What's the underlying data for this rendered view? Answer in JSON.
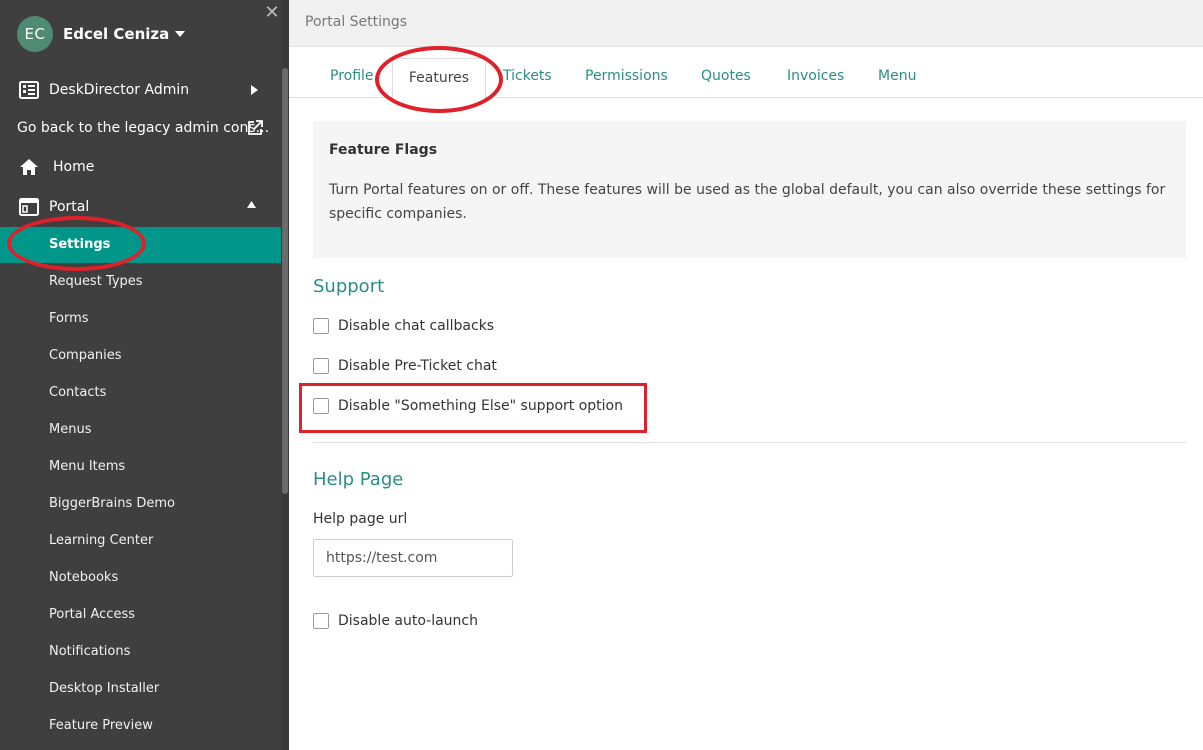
{
  "sidebar": {
    "user": {
      "initials": "EC",
      "name": "Edcel Ceniza"
    },
    "close_icon": "close-icon",
    "nav": {
      "deskdirector_admin": "DeskDirector Admin",
      "legacy_admin": "Go back to the legacy admin cons...",
      "home": "Home",
      "portal": "Portal"
    },
    "active_item": "Settings",
    "portal_items": [
      "Request Types",
      "Forms",
      "Companies",
      "Contacts",
      "Menus",
      "Menu Items",
      "BiggerBrains Demo",
      "Learning Center",
      "Notebooks",
      "Portal Access",
      "Notifications",
      "Desktop Installer",
      "Feature Preview"
    ]
  },
  "main": {
    "header_title": "Portal Settings",
    "tabs": [
      "Profile",
      "Features",
      "Tickets",
      "Permissions",
      "Quotes",
      "Invoices",
      "Menu"
    ],
    "active_tab": "Features",
    "feature_flags": {
      "title": "Feature Flags",
      "description": "Turn Portal features on or off. These features will be used as the global default, you can also override these settings for specific companies."
    },
    "support": {
      "title": "Support",
      "options": [
        {
          "label": "Disable chat callbacks",
          "checked": false
        },
        {
          "label": "Disable Pre-Ticket chat",
          "checked": false
        },
        {
          "label": "Disable \"Something Else\" support option",
          "checked": false
        }
      ]
    },
    "help_page": {
      "title": "Help Page",
      "url_label": "Help page url",
      "url_value": "https://test.com",
      "auto_launch": {
        "label": "Disable auto-launch",
        "checked": false
      }
    }
  },
  "colors": {
    "sidebar_bg": "#3f3f3f",
    "active_bg": "#00978a",
    "accent": "#2a8e85",
    "annotation": "#e0202a"
  }
}
